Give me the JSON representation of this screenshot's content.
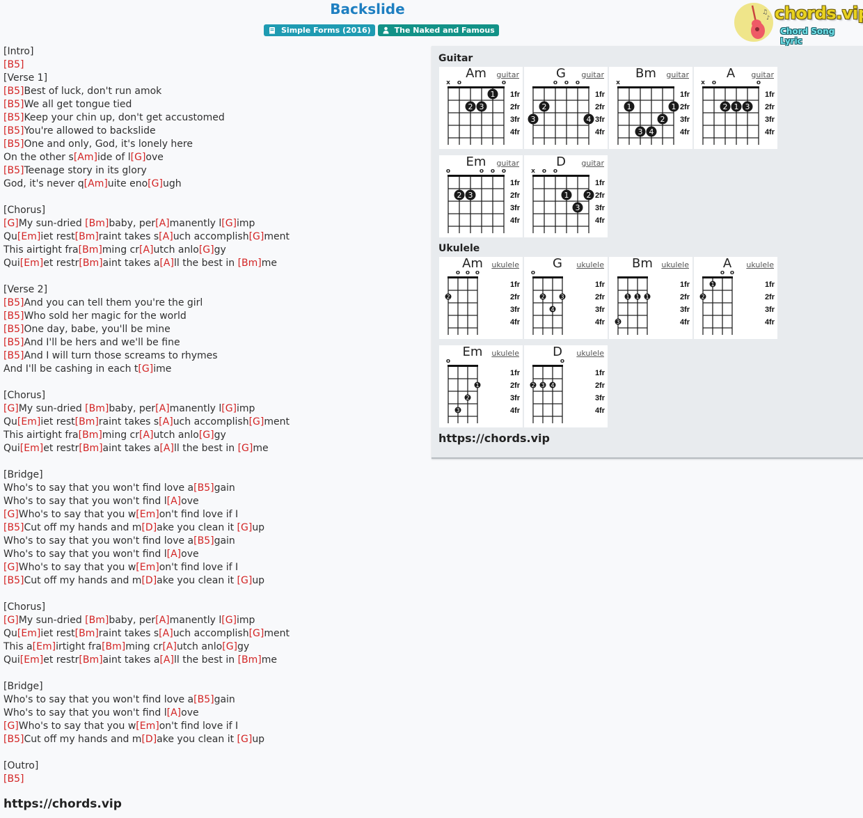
{
  "song": {
    "title": "Backslide",
    "album_label": "Simple Forms (2016)",
    "artist_label": "The Naked and Famous",
    "album_icon": "book-icon",
    "artist_icon": "user-icon"
  },
  "logo": {
    "brand": "chords.vip",
    "tagline": "Chord Song Lyric",
    "icon": "guitar-icon"
  },
  "lyrics": [
    [
      {
        "t": "[Intro]"
      }
    ],
    [
      {
        "c": "[B5]"
      }
    ],
    [
      {
        "t": "[Verse 1]"
      }
    ],
    [
      {
        "c": "[B5]"
      },
      {
        "t": "Best of luck, don't run amok"
      }
    ],
    [
      {
        "c": "[B5]"
      },
      {
        "t": "We all get tongue tied"
      }
    ],
    [
      {
        "c": "[B5]"
      },
      {
        "t": "Keep your chin up, don't get accustomed"
      }
    ],
    [
      {
        "c": "[B5]"
      },
      {
        "t": "You're allowed to backslide"
      }
    ],
    [
      {
        "c": "[B5]"
      },
      {
        "t": "One and only, God, it's lonely here"
      }
    ],
    [
      {
        "t": "On the other s"
      },
      {
        "c": "[Am]"
      },
      {
        "t": "ide of l"
      },
      {
        "c": "[G]"
      },
      {
        "t": "ove"
      }
    ],
    [
      {
        "c": "[B5]"
      },
      {
        "t": "Teenage story in its glory"
      }
    ],
    [
      {
        "t": "God, it's never q"
      },
      {
        "c": "[Am]"
      },
      {
        "t": "uite eno"
      },
      {
        "c": "[G]"
      },
      {
        "t": "ugh"
      }
    ],
    [],
    [
      {
        "t": "[Chorus]"
      }
    ],
    [
      {
        "c": "[G]"
      },
      {
        "t": "My sun-dried "
      },
      {
        "c": "[Bm]"
      },
      {
        "t": "baby, per"
      },
      {
        "c": "[A]"
      },
      {
        "t": "manently l"
      },
      {
        "c": "[G]"
      },
      {
        "t": "imp"
      }
    ],
    [
      {
        "t": "Qu"
      },
      {
        "c": "[Em]"
      },
      {
        "t": "iet rest"
      },
      {
        "c": "[Bm]"
      },
      {
        "t": "raint takes s"
      },
      {
        "c": "[A]"
      },
      {
        "t": "uch accomplish"
      },
      {
        "c": "[G]"
      },
      {
        "t": "ment"
      }
    ],
    [
      {
        "t": "This airtight fra"
      },
      {
        "c": "[Bm]"
      },
      {
        "t": "ming cr"
      },
      {
        "c": "[A]"
      },
      {
        "t": "utch anlo"
      },
      {
        "c": "[G]"
      },
      {
        "t": "gy"
      }
    ],
    [
      {
        "t": "Qui"
      },
      {
        "c": "[Em]"
      },
      {
        "t": "et restr"
      },
      {
        "c": "[Bm]"
      },
      {
        "t": "aint takes a"
      },
      {
        "c": "[A]"
      },
      {
        "t": "ll the best in "
      },
      {
        "c": "[Bm]"
      },
      {
        "t": "me"
      }
    ],
    [],
    [
      {
        "t": "[Verse 2]"
      }
    ],
    [
      {
        "c": "[B5]"
      },
      {
        "t": "And you can tell them you're the girl"
      }
    ],
    [
      {
        "c": "[B5]"
      },
      {
        "t": "Who sold her magic for the world"
      }
    ],
    [
      {
        "c": "[B5]"
      },
      {
        "t": "One day, babe, you'll be mine"
      }
    ],
    [
      {
        "c": "[B5]"
      },
      {
        "t": "And I'll be hers and we'll be fine"
      }
    ],
    [
      {
        "c": "[B5]"
      },
      {
        "t": "And I will turn those screams to rhymes"
      }
    ],
    [
      {
        "t": "And I'll be cashing in each t"
      },
      {
        "c": "[G]"
      },
      {
        "t": "ime"
      }
    ],
    [],
    [
      {
        "t": "[Chorus]"
      }
    ],
    [
      {
        "c": "[G]"
      },
      {
        "t": "My sun-dried "
      },
      {
        "c": "[Bm]"
      },
      {
        "t": "baby, per"
      },
      {
        "c": "[A]"
      },
      {
        "t": "manently l"
      },
      {
        "c": "[G]"
      },
      {
        "t": "imp"
      }
    ],
    [
      {
        "t": "Qu"
      },
      {
        "c": "[Em]"
      },
      {
        "t": "iet rest"
      },
      {
        "c": "[Bm]"
      },
      {
        "t": "raint takes s"
      },
      {
        "c": "[A]"
      },
      {
        "t": "uch accomplish"
      },
      {
        "c": "[G]"
      },
      {
        "t": "ment"
      }
    ],
    [
      {
        "t": "This airtight fra"
      },
      {
        "c": "[Bm]"
      },
      {
        "t": "ming cr"
      },
      {
        "c": "[A]"
      },
      {
        "t": "utch anlo"
      },
      {
        "c": "[G]"
      },
      {
        "t": "gy"
      }
    ],
    [
      {
        "t": "Qui"
      },
      {
        "c": "[Em]"
      },
      {
        "t": "et restr"
      },
      {
        "c": "[Bm]"
      },
      {
        "t": "aint takes a"
      },
      {
        "c": "[A]"
      },
      {
        "t": "ll the best in "
      },
      {
        "c": "[G]"
      },
      {
        "t": "me"
      }
    ],
    [],
    [
      {
        "t": "[Bridge]"
      }
    ],
    [
      {
        "t": "Who's to say that you won't find love a"
      },
      {
        "c": "[B5]"
      },
      {
        "t": "gain"
      }
    ],
    [
      {
        "t": "Who's to say that you won't find l"
      },
      {
        "c": "[A]"
      },
      {
        "t": "ove"
      }
    ],
    [
      {
        "c": "[G]"
      },
      {
        "t": "Who's to say that you w"
      },
      {
        "c": "[Em]"
      },
      {
        "t": "on't find love if I"
      }
    ],
    [
      {
        "c": "[B5]"
      },
      {
        "t": "Cut off my hands and m"
      },
      {
        "c": "[D]"
      },
      {
        "t": "ake you clean it "
      },
      {
        "c": "[G]"
      },
      {
        "t": "up"
      }
    ],
    [
      {
        "t": "Who's to say that you won't find love a"
      },
      {
        "c": "[B5]"
      },
      {
        "t": "gain"
      }
    ],
    [
      {
        "t": "Who's to say that you won't find l"
      },
      {
        "c": "[A]"
      },
      {
        "t": "ove"
      }
    ],
    [
      {
        "c": "[G]"
      },
      {
        "t": "Who's to say that you w"
      },
      {
        "c": "[Em]"
      },
      {
        "t": "on't find love if I"
      }
    ],
    [
      {
        "c": "[B5]"
      },
      {
        "t": "Cut off my hands and m"
      },
      {
        "c": "[D]"
      },
      {
        "t": "ake you clean it "
      },
      {
        "c": "[G]"
      },
      {
        "t": "up"
      }
    ],
    [],
    [
      {
        "t": "[Chorus]"
      }
    ],
    [
      {
        "c": "[G]"
      },
      {
        "t": "My sun-dried "
      },
      {
        "c": "[Bm]"
      },
      {
        "t": "baby, per"
      },
      {
        "c": "[A]"
      },
      {
        "t": "manently l"
      },
      {
        "c": "[G]"
      },
      {
        "t": "imp"
      }
    ],
    [
      {
        "t": "Qu"
      },
      {
        "c": "[Em]"
      },
      {
        "t": "iet rest"
      },
      {
        "c": "[Bm]"
      },
      {
        "t": "raint takes s"
      },
      {
        "c": "[A]"
      },
      {
        "t": "uch accomplish"
      },
      {
        "c": "[G]"
      },
      {
        "t": "ment"
      }
    ],
    [
      {
        "t": "This a"
      },
      {
        "c": "[Em]"
      },
      {
        "t": "irtight fra"
      },
      {
        "c": "[Bm]"
      },
      {
        "t": "ming cr"
      },
      {
        "c": "[A]"
      },
      {
        "t": "utch anlo"
      },
      {
        "c": "[G]"
      },
      {
        "t": "gy"
      }
    ],
    [
      {
        "t": "Qui"
      },
      {
        "c": "[Em]"
      },
      {
        "t": "et restr"
      },
      {
        "c": "[Bm]"
      },
      {
        "t": "aint takes a"
      },
      {
        "c": "[A]"
      },
      {
        "t": "ll the best in "
      },
      {
        "c": "[Bm]"
      },
      {
        "t": "me"
      }
    ],
    [],
    [
      {
        "t": "[Bridge]"
      }
    ],
    [
      {
        "t": "Who's to say that you won't find love a"
      },
      {
        "c": "[B5]"
      },
      {
        "t": "gain"
      }
    ],
    [
      {
        "t": "Who's to say that you won't find l"
      },
      {
        "c": "[A]"
      },
      {
        "t": "ove"
      }
    ],
    [
      {
        "c": "[G]"
      },
      {
        "t": "Who's to say that you w"
      },
      {
        "c": "[Em]"
      },
      {
        "t": "on't find love if I"
      }
    ],
    [
      {
        "c": "[B5]"
      },
      {
        "t": "Cut off my hands and m"
      },
      {
        "c": "[D]"
      },
      {
        "t": "ake you clean it "
      },
      {
        "c": "[G]"
      },
      {
        "t": "up"
      }
    ],
    [],
    [
      {
        "t": "[Outro]"
      }
    ],
    [
      {
        "c": "[B5]"
      }
    ]
  ],
  "lyrics_footer_url": "https://chords.vip",
  "panel": {
    "guitar_heading": "Guitar",
    "ukulele_heading": "Ukulele",
    "footer_url": "https://chords.vip",
    "fret_labels": [
      "1fr",
      "2fr",
      "3fr",
      "4fr"
    ],
    "guitar": [
      {
        "name": "Am",
        "inst": "guitar",
        "strings": [
          "x",
          "o",
          "",
          "",
          "",
          "o"
        ],
        "dots": [
          [
            5,
            1,
            "1"
          ],
          [
            3,
            2,
            "2"
          ],
          [
            4,
            2,
            "3"
          ]
        ]
      },
      {
        "name": "G",
        "inst": "guitar",
        "strings": [
          "",
          "",
          "o",
          "o",
          "o",
          ""
        ],
        "dots": [
          [
            2,
            2,
            "2"
          ],
          [
            1,
            3,
            "3"
          ],
          [
            6,
            3,
            "4"
          ]
        ]
      },
      {
        "name": "Bm",
        "inst": "guitar",
        "strings": [
          "x",
          "",
          "",
          "",
          "",
          ""
        ],
        "dots": [
          [
            2,
            2,
            "1"
          ],
          [
            6,
            2,
            "1"
          ],
          [
            5,
            3,
            "2"
          ],
          [
            3,
            4,
            "3"
          ],
          [
            4,
            4,
            "4"
          ]
        ]
      },
      {
        "name": "A",
        "inst": "guitar",
        "strings": [
          "x",
          "o",
          "",
          "",
          "",
          "o"
        ],
        "dots": [
          [
            3,
            2,
            "2"
          ],
          [
            4,
            2,
            "1"
          ],
          [
            5,
            2,
            "3"
          ]
        ]
      },
      {
        "name": "Em",
        "inst": "guitar",
        "strings": [
          "o",
          "",
          "",
          "o",
          "o",
          "o"
        ],
        "dots": [
          [
            2,
            2,
            "2"
          ],
          [
            3,
            2,
            "3"
          ]
        ]
      },
      {
        "name": "D",
        "inst": "guitar",
        "strings": [
          "x",
          "o",
          "o",
          "",
          "",
          ""
        ],
        "dots": [
          [
            4,
            2,
            "1"
          ],
          [
            6,
            2,
            "2"
          ],
          [
            5,
            3,
            "3"
          ]
        ]
      }
    ],
    "ukulele": [
      {
        "name": "Am",
        "inst": "ukulele",
        "strings": [
          "",
          "o",
          "o",
          "o"
        ],
        "dots": [
          [
            1,
            2,
            "2"
          ]
        ]
      },
      {
        "name": "G",
        "inst": "ukulele",
        "strings": [
          "o",
          "",
          "",
          ""
        ],
        "dots": [
          [
            2,
            2,
            "2"
          ],
          [
            4,
            2,
            "3"
          ],
          [
            3,
            3,
            "4"
          ]
        ]
      },
      {
        "name": "Bm",
        "inst": "ukulele",
        "strings": [
          "",
          "",
          "",
          ""
        ],
        "dots": [
          [
            2,
            2,
            "1"
          ],
          [
            3,
            2,
            "1"
          ],
          [
            4,
            2,
            "1"
          ],
          [
            1,
            4,
            "3"
          ]
        ]
      },
      {
        "name": "A",
        "inst": "ukulele",
        "strings": [
          "",
          "",
          "o",
          "o"
        ],
        "dots": [
          [
            2,
            1,
            "1"
          ],
          [
            1,
            2,
            "2"
          ]
        ]
      },
      {
        "name": "Em",
        "inst": "ukulele",
        "strings": [
          "o",
          "",
          "",
          ""
        ],
        "dots": [
          [
            4,
            2,
            "1"
          ],
          [
            3,
            3,
            "2"
          ],
          [
            2,
            4,
            "3"
          ]
        ]
      },
      {
        "name": "D",
        "inst": "ukulele",
        "strings": [
          "",
          "",
          "",
          "o"
        ],
        "dots": [
          [
            1,
            2,
            "2"
          ],
          [
            2,
            2,
            "3"
          ],
          [
            3,
            2,
            "4"
          ]
        ]
      }
    ]
  },
  "colors": {
    "title": "#1e7fc1",
    "chord": "#d32424",
    "album_badge": "#1f9bb2",
    "artist_badge": "#129287",
    "panel_bg": "#e8ebee"
  }
}
